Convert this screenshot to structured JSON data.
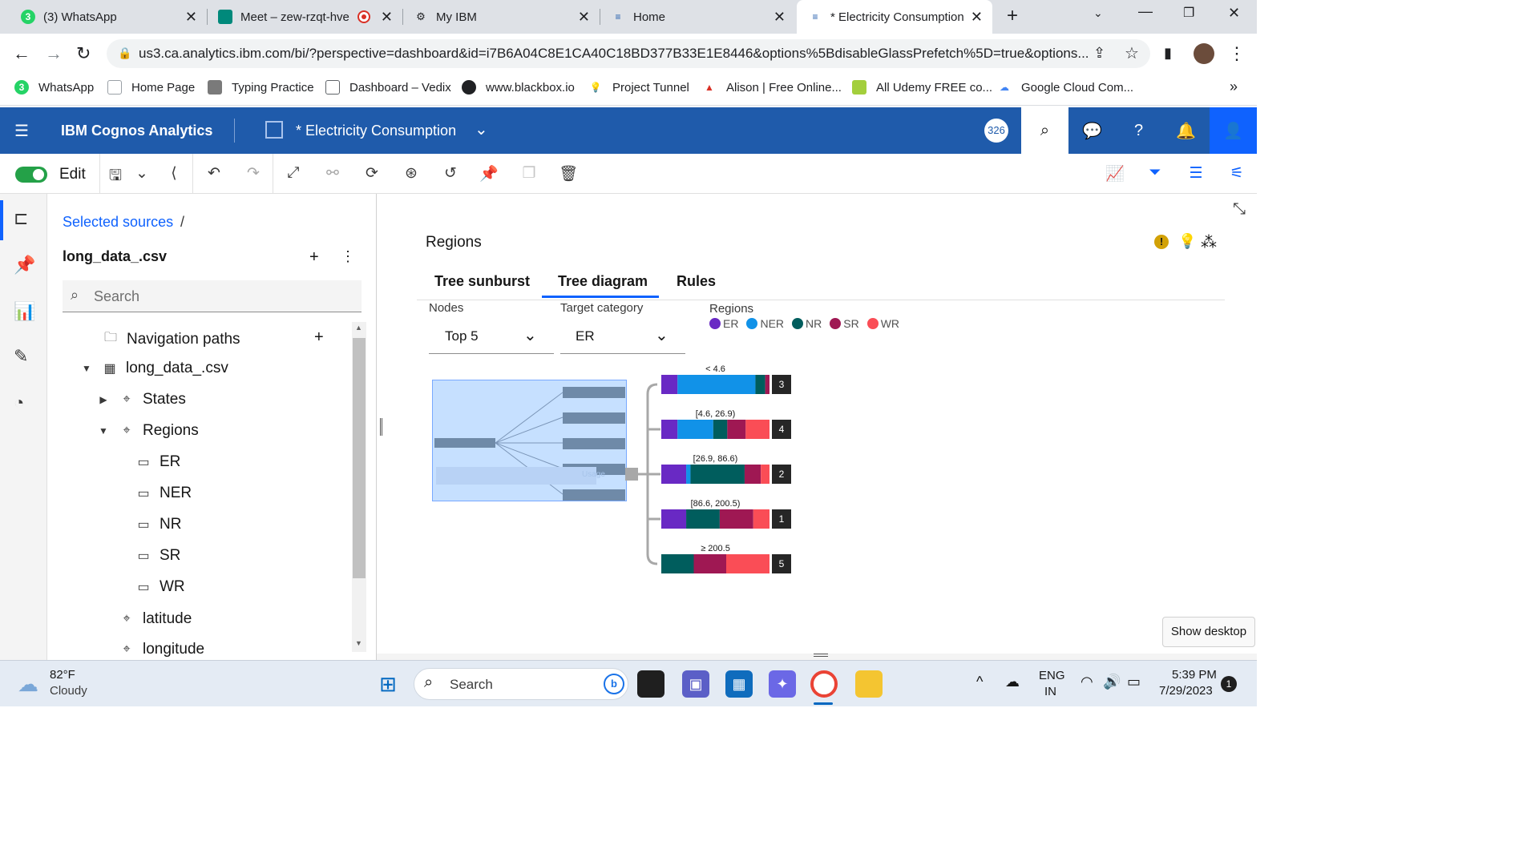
{
  "browser": {
    "tabs": [
      {
        "label": "(3) WhatsApp",
        "icon": "whatsapp-icon"
      },
      {
        "label": "Meet – zew-rzqt-hve",
        "icon": "meet-icon"
      },
      {
        "label": "My IBM",
        "icon": "ibm-icon"
      },
      {
        "label": "Home",
        "icon": "home-icon"
      },
      {
        "label": "* Electricity Consumption",
        "icon": "cognos-icon"
      }
    ],
    "url": "us3.ca.analytics.ibm.com/bi/?perspective=dashboard&id=i7B6A04C8E1CA40C18BD377B33E1E8446&options%5BdisableGlassPrefetch%5D=true&options...",
    "bookmarks": [
      "WhatsApp",
      "Home Page",
      "Typing Practice",
      "Dashboard – Vedix",
      "www.blackbox.io",
      "Project Tunnel",
      "Alison | Free Online...",
      "All Udemy FREE co...",
      "Google Cloud Com..."
    ],
    "whatsapp_badge": "3",
    "more_bookmarks": "»"
  },
  "header": {
    "product": "IBM Cognos Analytics",
    "dashboard_title": "* Electricity Consumption",
    "user_badge": "326"
  },
  "toolbar": {
    "edit_label": "Edit"
  },
  "source_panel": {
    "breadcrumb": "Selected sources",
    "breadcrumb_sep": "/",
    "source_name": "long_data_.csv",
    "search_placeholder": "Search",
    "tree": [
      {
        "label": "Navigation paths"
      },
      {
        "label": "long_data_.csv"
      },
      {
        "label": "States"
      },
      {
        "label": "Regions"
      },
      {
        "label": "ER"
      },
      {
        "label": "NER"
      },
      {
        "label": "NR"
      },
      {
        "label": "SR"
      },
      {
        "label": "WR"
      },
      {
        "label": "latitude"
      },
      {
        "label": "longitude"
      }
    ]
  },
  "widget": {
    "title": "Regions",
    "tabs": [
      "Tree sunburst",
      "Tree diagram",
      "Rules"
    ],
    "active_tab": "Tree diagram",
    "nodes_label": "Nodes",
    "nodes_value": "Top 5",
    "target_label": "Target category",
    "target_value": "ER",
    "legend_title": "Regions",
    "legend": [
      {
        "name": "ER",
        "color": "#6929c4"
      },
      {
        "name": "NER",
        "color": "#1192e8"
      },
      {
        "name": "NR",
        "color": "#005d5d"
      },
      {
        "name": "SR",
        "color": "#9f1853"
      },
      {
        "name": "WR",
        "color": "#fa4d56"
      }
    ],
    "overview_label": "Usage"
  },
  "chart_data": {
    "type": "bar",
    "title": "",
    "orientation": "horizontal-stacked",
    "categories": [
      "< 4.6",
      "[4.6, 26.9)",
      "[26.9, 86.6)",
      "[86.6, 200.5)",
      "≥ 200.5"
    ],
    "rank_labels": [
      "3",
      "4",
      "2",
      "1",
      "5"
    ],
    "series": [
      {
        "name": "ER",
        "values": [
          0.15,
          0.15,
          0.23,
          0.23,
          0.0
        ]
      },
      {
        "name": "NER",
        "values": [
          0.72,
          0.33,
          0.04,
          0.0,
          0.0
        ]
      },
      {
        "name": "NR",
        "values": [
          0.09,
          0.13,
          0.5,
          0.31,
          0.3
        ]
      },
      {
        "name": "SR",
        "values": [
          0.04,
          0.17,
          0.15,
          0.31,
          0.3
        ]
      },
      {
        "name": "WR",
        "values": [
          0.0,
          0.22,
          0.08,
          0.15,
          0.4
        ]
      }
    ]
  },
  "taskbar": {
    "weather_temp": "82°F",
    "weather_desc": "Cloudy",
    "search": "Search",
    "lang1": "ENG",
    "lang2": "IN",
    "time": "5:39 PM",
    "date": "7/29/2023",
    "notif": "1",
    "show_desktop": "Show desktop"
  }
}
